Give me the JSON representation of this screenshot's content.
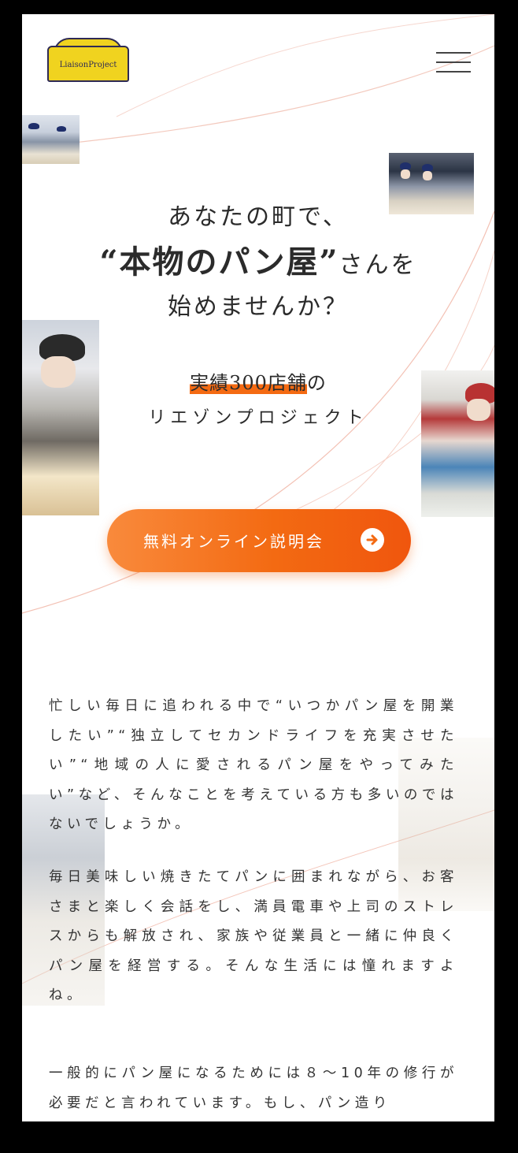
{
  "header": {
    "logo_text": "LiaisonProject",
    "menu_icon": "hamburger-menu-icon"
  },
  "hero": {
    "line1": "あなたの町で、",
    "line2_main": "“本物のパン屋”",
    "line2_tail": "さんを",
    "line3": "始めませんか？",
    "achievement_highlight": "実績300店舗",
    "achievement_tail": "の",
    "project_name": "リエゾンプロジェクト"
  },
  "cta": {
    "label": "無料オンライン説明会",
    "icon": "arrow-right-circle-icon"
  },
  "body": {
    "paragraph1": "忙しい毎日に追われる中で“いつかパン屋を開業したい”“独立してセカンドライフを充実させたい”“地域の人に愛されるパン屋をやってみたい”など、そんなことを考えている方も多いのではないでしょうか。",
    "paragraph2": "毎日美味しい焼きたてパンに囲まれながら、お客さまと楽しく会話をし、満員電車や上司のストレスからも解放され、家族や従業員と一緒に仲良くパン屋を経営する。そんな生活には憧れますよね。",
    "paragraph3": "一般的にパン屋になるためには８～10年の修行が必要だと言われています。もし、パン造り"
  },
  "colors": {
    "accent_orange": "#f36a12",
    "logo_yellow": "#f0d31f",
    "logo_navy": "#2e2a55"
  }
}
